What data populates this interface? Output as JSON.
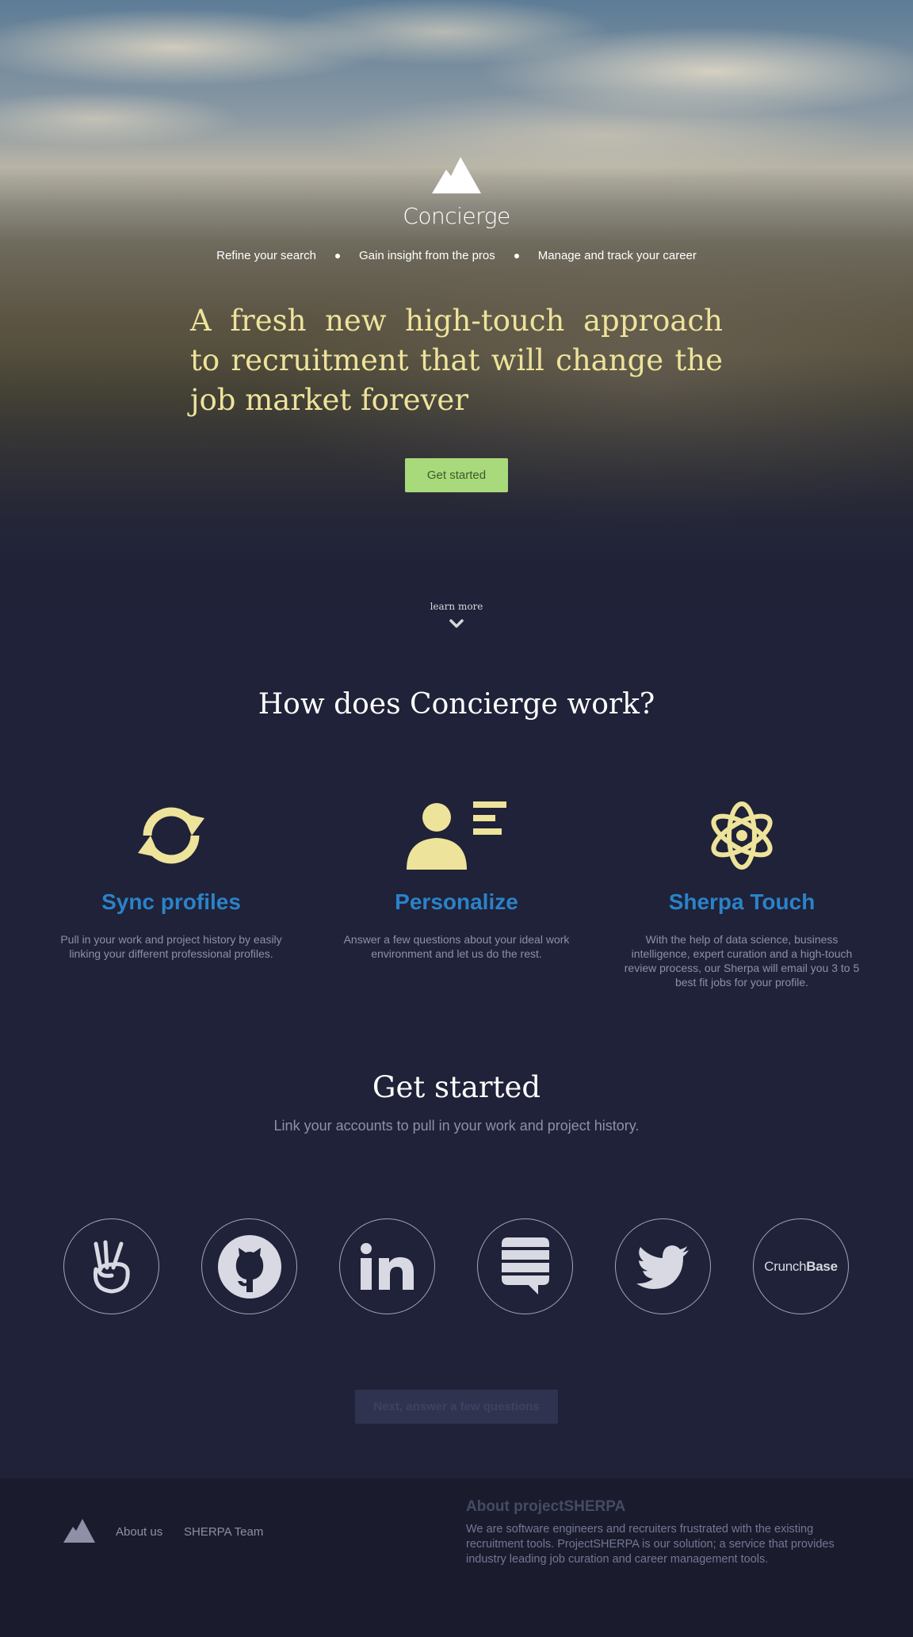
{
  "brand": {
    "name": "Concierge",
    "icon": "mountain-logo-icon"
  },
  "hero": {
    "taglines": [
      "Refine your search",
      "Gain insight from the pros",
      "Manage and track your career"
    ],
    "headline": "A fresh new high-touch approach to recruitment that will change the job market forever",
    "cta_label": "Get started",
    "learn_more": "learn more"
  },
  "how": {
    "title": "How does Concierge work?",
    "features": [
      {
        "icon": "sync-arrows-icon",
        "title": "Sync profiles",
        "desc": "Pull in your work and project history by easily linking your different professional profiles."
      },
      {
        "icon": "person-list-icon",
        "title": "Personalize",
        "desc": "Answer a few questions about your ideal work environment and let us do the rest."
      },
      {
        "icon": "atom-icon",
        "title": "Sherpa Touch",
        "desc": "With the help of data science, business intelligence, expert curation and a high-touch review process, our Sherpa will email you 3 to 5 best fit jobs for your profile."
      }
    ]
  },
  "get_started": {
    "title": "Get started",
    "subtitle": "Link your accounts to pull in your work and project history.",
    "accounts": [
      {
        "icon": "angellist-icon"
      },
      {
        "icon": "github-icon"
      },
      {
        "icon": "linkedin-icon",
        "text": "in"
      },
      {
        "icon": "stackexchange-icon"
      },
      {
        "icon": "twitter-icon"
      },
      {
        "icon": "crunchbase-icon",
        "text_light": "Crunch",
        "text_bold": "Base"
      }
    ],
    "next_label": "Next, answer a few questions"
  },
  "footer": {
    "links": [
      "About us",
      "SHERPA Team"
    ],
    "about_title": "About projectSHERPA",
    "about_text": "We are software engineers and recruiters frustrated with the existing recruitment tools. ProjectSHERPA is our solution; a service that provides industry leading job curation and career management tools."
  },
  "colors": {
    "background": "#1f2238",
    "accent_yellow": "#eee39a",
    "accent_blue": "#2b82c9",
    "cta_green": "#a8d97a",
    "footer_bg": "#1a1c2d"
  }
}
